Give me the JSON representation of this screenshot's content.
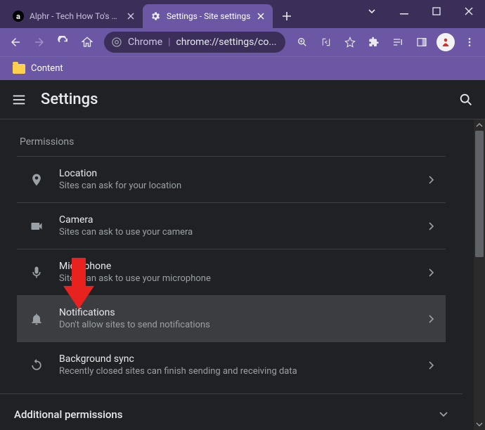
{
  "window": {
    "tabs": [
      {
        "title": "Alphr - Tech How To's & ...",
        "favicon": "alphr"
      },
      {
        "title": "Settings - Site settings",
        "favicon": "gear"
      }
    ]
  },
  "toolbar": {
    "omnibox_prefix": "Chrome",
    "omnibox_url": "chrome://settings/co..."
  },
  "bookmarks": {
    "items": [
      {
        "label": "Content"
      }
    ]
  },
  "appbar": {
    "title": "Settings"
  },
  "section": {
    "title": "Permissions"
  },
  "rows": [
    {
      "icon": "location",
      "title": "Location",
      "sub": "Sites can ask for your location"
    },
    {
      "icon": "camera",
      "title": "Camera",
      "sub": "Sites can ask to use your camera"
    },
    {
      "icon": "microphone",
      "title": "Microphone",
      "sub": "Sites can ask to use your microphone"
    },
    {
      "icon": "bell",
      "title": "Notifications",
      "sub": "Don't allow sites to send notifications"
    },
    {
      "icon": "sync",
      "title": "Background sync",
      "sub": "Recently closed sites can finish sending and receiving data"
    }
  ],
  "additional": {
    "label": "Additional permissions"
  }
}
